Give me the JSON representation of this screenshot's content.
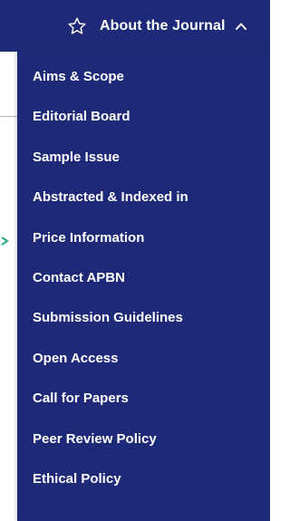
{
  "header": {
    "title": "About the Journal",
    "star_icon": "star-outline-icon",
    "chevron_icon": "chevron-up-icon"
  },
  "menu": {
    "items": [
      {
        "label": "Aims & Scope"
      },
      {
        "label": "Editorial Board"
      },
      {
        "label": "Sample Issue"
      },
      {
        "label": "Abstracted & Indexed in"
      },
      {
        "label": "Price Information"
      },
      {
        "label": "Contact APBN"
      },
      {
        "label": "Submission Guidelines"
      },
      {
        "label": "Open Access"
      },
      {
        "label": "Call for Papers"
      },
      {
        "label": "Peer Review Policy"
      },
      {
        "label": "Ethical Policy"
      }
    ]
  },
  "colors": {
    "menu_background": "#1e2a78",
    "menu_text": "#ffffff",
    "accent_arrow": "#2aa88a"
  }
}
